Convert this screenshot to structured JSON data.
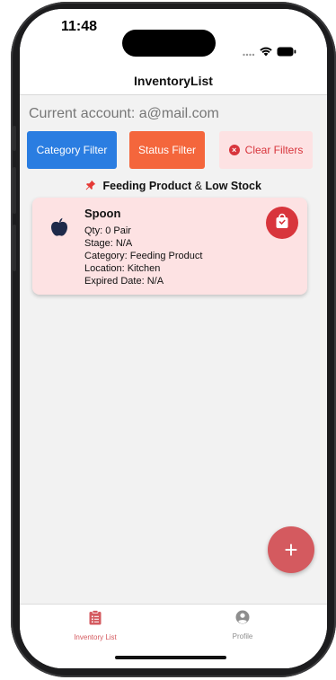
{
  "status_bar": {
    "time": "11:48"
  },
  "header": {
    "title": "InventoryList"
  },
  "account": {
    "text": "Current account: a@mail.com"
  },
  "filters": {
    "category_label": "Category Filter",
    "status_label": "Status Filter",
    "clear_label": "Clear Filters",
    "summary_category": "Feeding Product",
    "summary_amp": "&",
    "summary_status": "Low Stock"
  },
  "items": [
    {
      "name": "Spoon",
      "qty": "Qty: 0 Pair",
      "stage": "Stage: N/A",
      "category": "Category: Feeding Product",
      "location": "Location: Kitchen",
      "expired": "Expired Date: N/A"
    }
  ],
  "fab": {
    "label": "+"
  },
  "tabs": [
    {
      "label": "Inventory List",
      "active": true
    },
    {
      "label": "Profile",
      "active": false
    }
  ],
  "colors": {
    "accent": "#d45a5f",
    "category_button": "#2a7de1",
    "status_button": "#f4663c",
    "clear_button_bg": "#fde2e3",
    "card_bg": "#fde2e3"
  }
}
